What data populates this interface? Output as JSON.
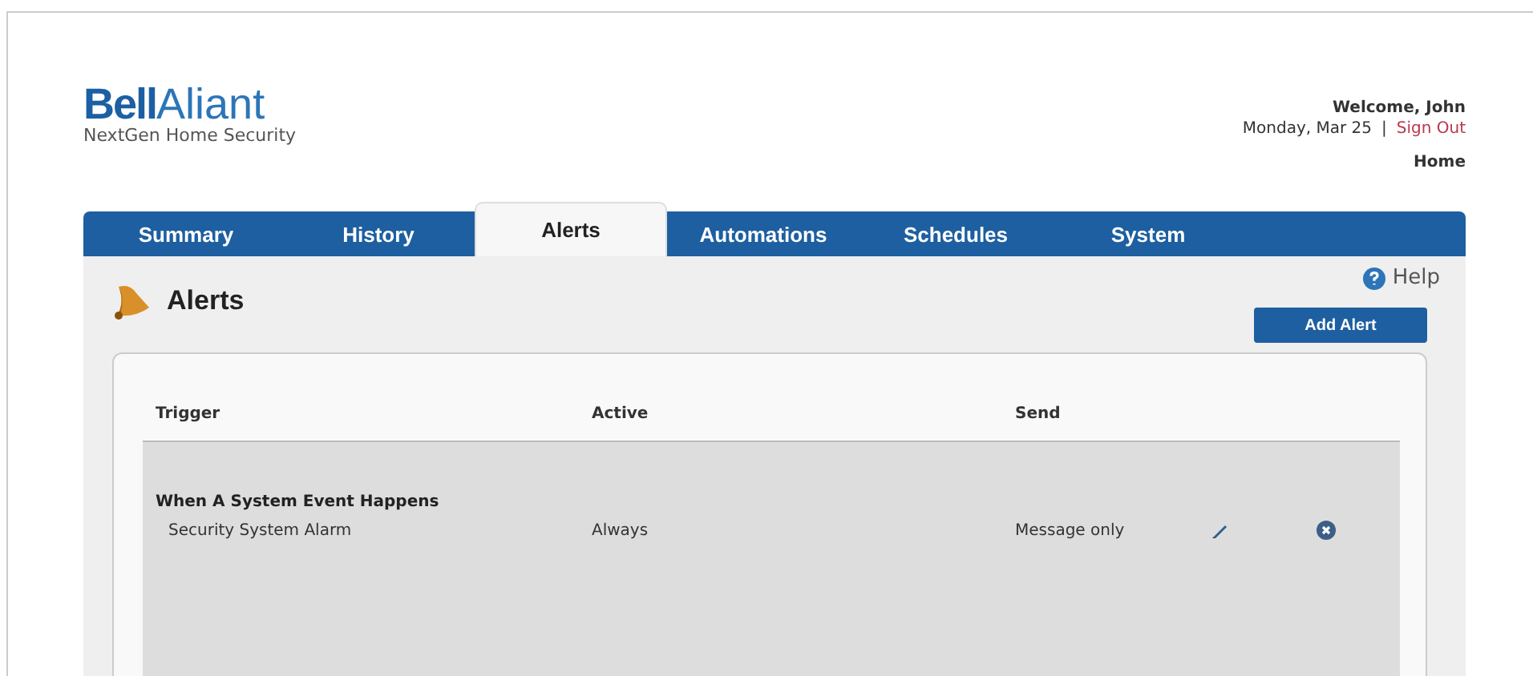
{
  "logo": {
    "brand_bold": "Bell",
    "brand_light": "Aliant",
    "tagline": "NextGen Home Security"
  },
  "user": {
    "welcome": "Welcome, John",
    "date": "Monday, Mar 25",
    "separator": "|",
    "sign_out": "Sign Out",
    "home": "Home"
  },
  "tabs": [
    {
      "label": "Summary",
      "selected": false
    },
    {
      "label": "History",
      "selected": false
    },
    {
      "label": "Alerts",
      "selected": true
    },
    {
      "label": "Automations",
      "selected": false
    },
    {
      "label": "Schedules",
      "selected": false
    },
    {
      "label": "System",
      "selected": false
    }
  ],
  "page": {
    "title": "Alerts",
    "help": "Help",
    "add_button": "Add Alert"
  },
  "table": {
    "columns": [
      "Trigger",
      "Active",
      "Send"
    ],
    "groups": [
      {
        "title": "When A System Event Happens",
        "rows": [
          {
            "trigger": "Security System Alarm",
            "active": "Always",
            "send": "Message only"
          }
        ]
      }
    ]
  }
}
